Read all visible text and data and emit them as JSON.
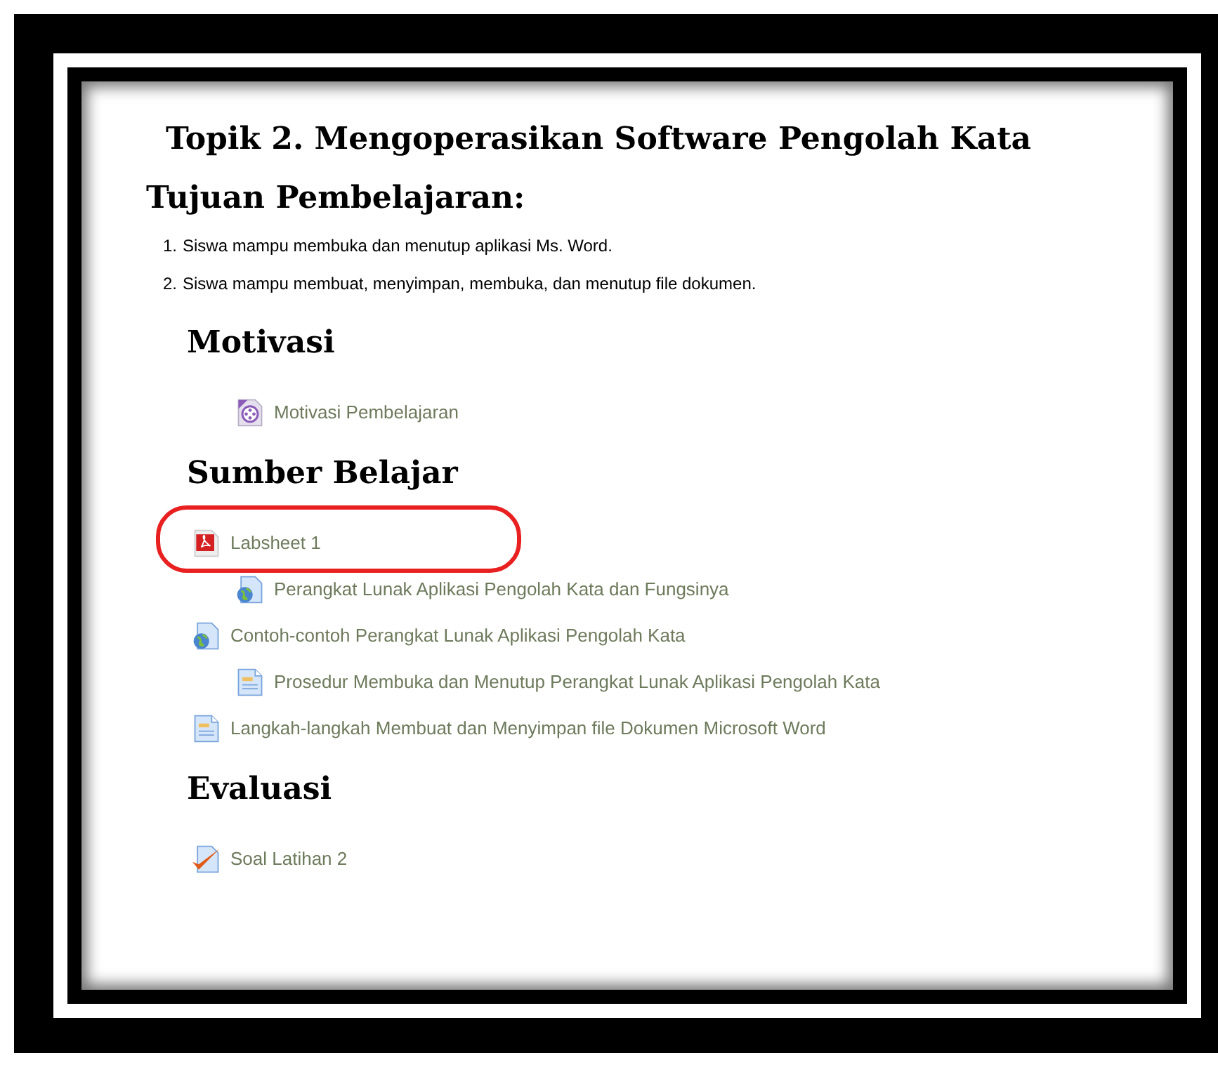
{
  "title": "Topik 2. Mengoperasikan Software Pengolah Kata",
  "objectives": {
    "heading": "Tujuan Pembelajaran:",
    "items": [
      {
        "number": "1.",
        "text": "Siswa mampu membuka dan menutup aplikasi Ms. Word."
      },
      {
        "number": "2.",
        "text": "Siswa mampu membuat, menyimpan, membuka, dan menutup file dokumen."
      }
    ]
  },
  "sections": [
    {
      "heading": "Motivasi",
      "activities": [
        {
          "kind": "video",
          "label": "Motivasi Pembelajaran",
          "indented": true,
          "highlighted": false
        }
      ]
    },
    {
      "heading": "Sumber Belajar",
      "activities": [
        {
          "kind": "pdf",
          "label": "Labsheet 1",
          "indented": false,
          "highlighted": true
        },
        {
          "kind": "url",
          "label": "Perangkat Lunak Aplikasi Pengolah Kata dan Fungsinya",
          "indented": true,
          "highlighted": false
        },
        {
          "kind": "url",
          "label": "Contoh-contoh Perangkat Lunak Aplikasi Pengolah Kata",
          "indented": false,
          "highlighted": false
        },
        {
          "kind": "page",
          "label": "Prosedur Membuka dan Menutup Perangkat Lunak Aplikasi Pengolah Kata",
          "indented": true,
          "highlighted": false
        },
        {
          "kind": "page",
          "label": "Langkah-langkah Membuat dan Menyimpan file Dokumen Microsoft Word",
          "indented": false,
          "highlighted": false
        }
      ]
    },
    {
      "heading": "Evaluasi",
      "activities": [
        {
          "kind": "quiz",
          "label": "Soal Latihan 2",
          "indented": false,
          "highlighted": false
        }
      ]
    }
  ]
}
